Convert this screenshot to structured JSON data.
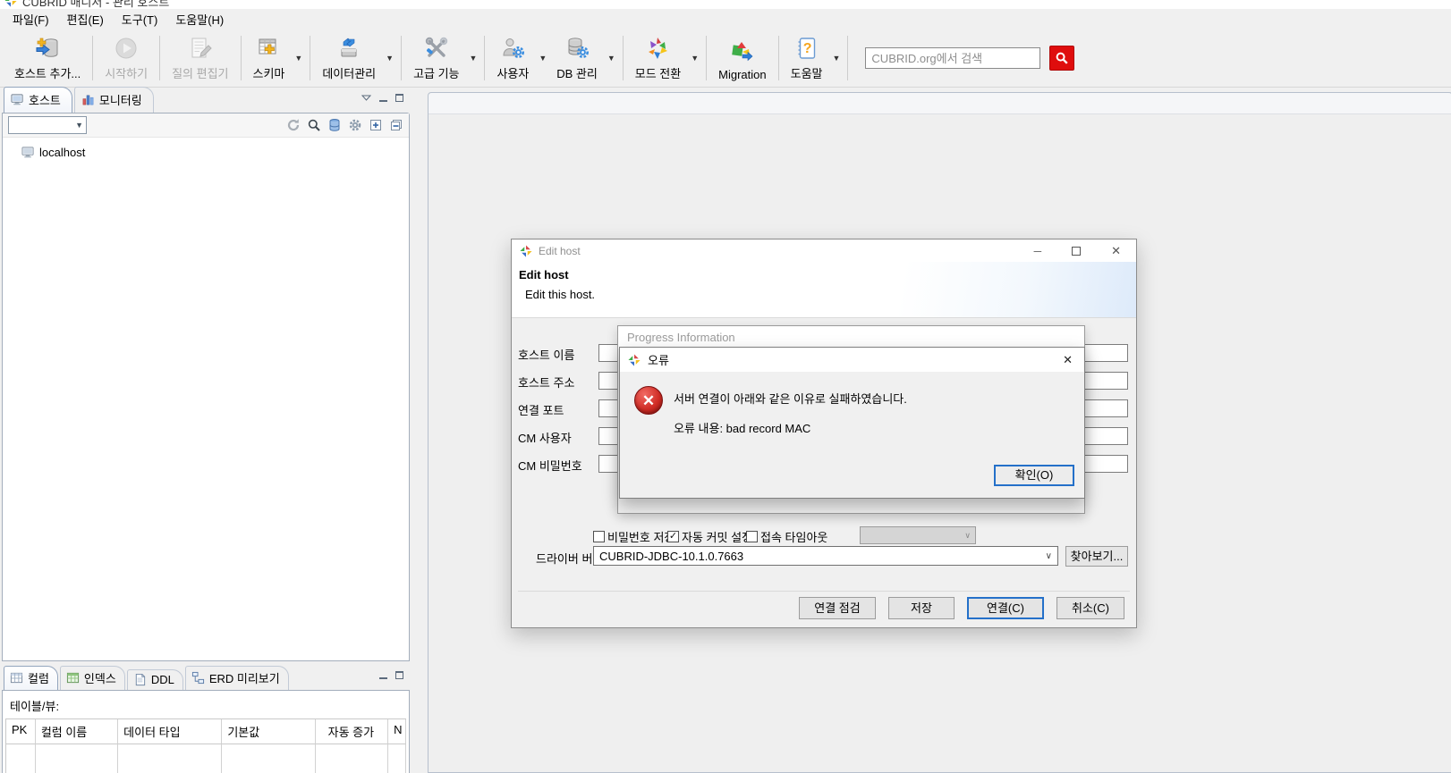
{
  "window": {
    "title": "CUBRID 매니저 - 관리 호스트"
  },
  "menubar": {
    "items": [
      {
        "label": "파일(F)"
      },
      {
        "label": "편집(E)"
      },
      {
        "label": "도구(T)"
      },
      {
        "label": "도움말(H)"
      }
    ]
  },
  "toolbar": {
    "buttons": [
      {
        "label": "호스트 추가...",
        "icon": "add-host-icon",
        "state": "enabled",
        "has_dropdown": false
      },
      {
        "label": "시작하기",
        "icon": "start-icon",
        "state": "disabled",
        "has_dropdown": false
      },
      {
        "label": "질의 편집기",
        "icon": "query-editor-icon",
        "state": "disabled",
        "has_dropdown": false
      },
      {
        "label": "스키마",
        "icon": "schema-icon",
        "state": "enabled",
        "has_dropdown": true
      },
      {
        "label": "데이터관리",
        "icon": "data-management-icon",
        "state": "enabled",
        "has_dropdown": true
      },
      {
        "label": "고급 기능",
        "icon": "advanced-features-icon",
        "state": "enabled",
        "has_dropdown": true
      },
      {
        "label": "사용자",
        "icon": "user-management-icon",
        "state": "enabled",
        "has_dropdown": true
      },
      {
        "label": "DB 관리",
        "icon": "db-admin-icon",
        "state": "enabled",
        "has_dropdown": true
      },
      {
        "label": "모드 전환",
        "icon": "mode-switch-icon",
        "state": "enabled",
        "has_dropdown": true
      },
      {
        "label": "Migration",
        "icon": "migration-icon",
        "state": "enabled",
        "has_dropdown": false
      },
      {
        "label": "도움말",
        "icon": "help-icon",
        "state": "enabled",
        "has_dropdown": true
      }
    ],
    "search": {
      "placeholder": "CUBRID.org에서 검색",
      "button_icon": "search-icon",
      "button_color": "#df0d0d"
    }
  },
  "left_panel": {
    "tabs": [
      {
        "label": "호스트",
        "icon": "host-tab-icon",
        "active": true
      },
      {
        "label": "모니터링",
        "icon": "monitoring-tab-icon",
        "active": false
      }
    ],
    "filter_combo": {
      "value": ""
    },
    "toolbar_icons": [
      "refresh-icon",
      "search-tree-icon",
      "database-filter-icon",
      "settings-icon",
      "expand-all-icon",
      "collapse-all-icon"
    ],
    "tree": [
      {
        "label": "localhost",
        "icon": "host-node-icon"
      }
    ]
  },
  "bottom_panel": {
    "tabs": [
      {
        "label": "컬럼",
        "icon": "columns-tab-icon",
        "active": true
      },
      {
        "label": "인덱스",
        "icon": "index-tab-icon",
        "active": false
      },
      {
        "label": "DDL",
        "icon": "ddl-tab-icon",
        "active": false
      },
      {
        "label": "ERD 미리보기",
        "icon": "erd-tab-icon",
        "active": false
      }
    ],
    "table_view_label": "테이블/뷰:",
    "columns": [
      "PK",
      "컬럼 이름",
      "데이터 타입",
      "기본값",
      "자동 증가",
      "N"
    ]
  },
  "edit_host_dialog": {
    "window_title": "Edit host",
    "header_title": "Edit host",
    "header_subtitle": "Edit this host.",
    "fields": [
      {
        "label": "호스트 이름",
        "value": ""
      },
      {
        "label": "호스트 주소",
        "value": ""
      },
      {
        "label": "연결 포트",
        "value": ""
      },
      {
        "label": "CM 사용자",
        "value": ""
      },
      {
        "label": "CM 비밀번호",
        "value": ""
      }
    ],
    "checkboxes": [
      {
        "label": "비밀번호 저장",
        "checked": false,
        "glyph": ""
      },
      {
        "label": "자동 커밋 설정",
        "checked": true,
        "glyph": "✓"
      },
      {
        "label": "접속 타임아웃",
        "checked": false,
        "glyph": ""
      }
    ],
    "timeout_combo": {
      "value": "",
      "disabled": true
    },
    "driver": {
      "label": "드라이버 버전",
      "value": "CUBRID-JDBC-10.1.0.7663",
      "browse_label": "찾아보기..."
    },
    "buttons": [
      {
        "label": "연결 점검",
        "focused": false
      },
      {
        "label": "저장",
        "focused": false
      },
      {
        "label": "연결(C)",
        "focused": true
      },
      {
        "label": "취소(C)",
        "focused": false
      }
    ]
  },
  "progress_dialog": {
    "title": "Progress Information"
  },
  "error_dialog": {
    "title": "오류",
    "message": "서버 연결이 아래와 같은 이유로 실패하였습니다.",
    "detail": "오류 내용: bad record MAC",
    "ok_label": "확인(O)",
    "close_glyph": "✕"
  }
}
